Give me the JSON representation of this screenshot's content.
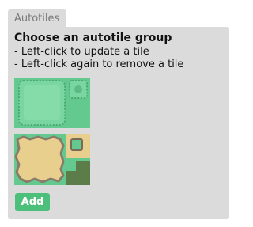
{
  "tab": {
    "label": "Autotiles"
  },
  "panel": {
    "title": "Choose an autotile group",
    "instructions": [
      "- Left-click to update a tile",
      "- Left-click again to remove a tile"
    ]
  },
  "tiles": [
    {
      "name": "grass-autotile"
    },
    {
      "name": "sand-autotile"
    }
  ],
  "actions": {
    "add_label": "Add"
  },
  "colors": {
    "panel": "#dbdbdb",
    "grass": "#63c98f",
    "grass_dark": "#3f8e5f",
    "sand": "#e8cf8e",
    "sand_dark": "#b49253",
    "dark_grass": "#5c7d4a",
    "button": "#4cc07a"
  }
}
